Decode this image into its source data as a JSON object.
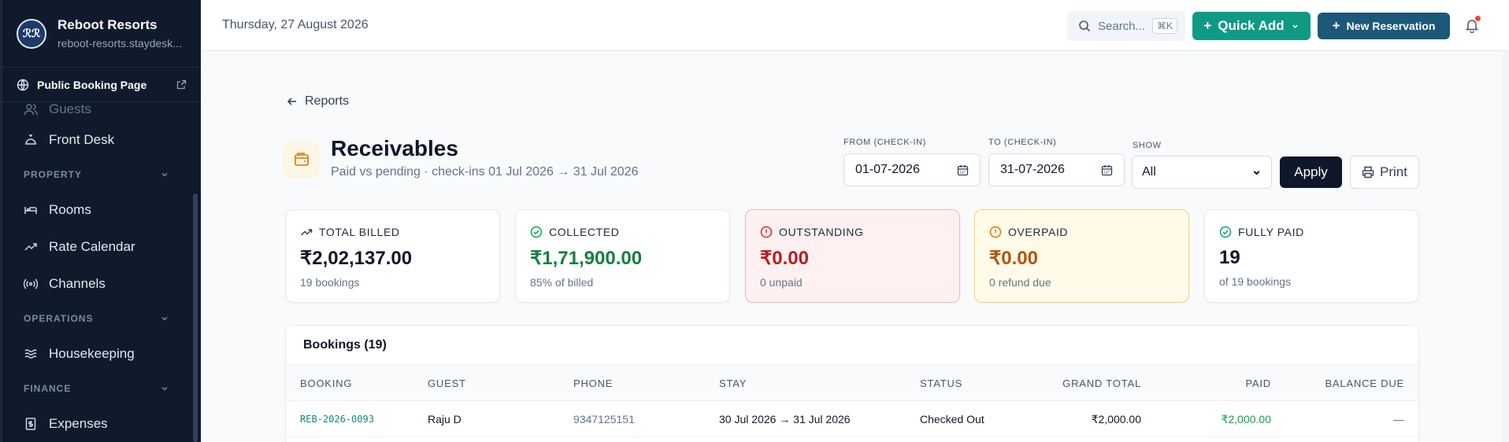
{
  "sidebar": {
    "brand_name": "Reboot Resorts",
    "brand_sub": "reboot-resorts.staydesk...",
    "logo_text": "ℛℛ",
    "public_link": "Public Booking Page",
    "items_top": [
      {
        "label": "Guests",
        "icon": "users-icon"
      },
      {
        "label": "Front Desk",
        "icon": "bell-service-icon"
      }
    ],
    "section_property": "PROPERTY",
    "items_property": [
      {
        "label": "Rooms",
        "icon": "bed-icon"
      },
      {
        "label": "Rate Calendar",
        "icon": "trending-up-icon"
      },
      {
        "label": "Channels",
        "icon": "broadcast-icon"
      }
    ],
    "section_operations": "OPERATIONS",
    "items_operations": [
      {
        "label": "Housekeeping",
        "icon": "waves-icon"
      }
    ],
    "section_finance": "FINANCE",
    "items_finance": [
      {
        "label": "Expenses",
        "icon": "receipt-icon"
      }
    ]
  },
  "topbar": {
    "date": "Thursday, 27 August 2026",
    "search_placeholder": "Search...",
    "search_shortcut": "⌘K",
    "quick_add": "Quick Add",
    "new_reservation": "New Reservation"
  },
  "page": {
    "back_label": "Reports",
    "title": "Receivables",
    "subtitle": "Paid vs pending · check-ins 01 Jul 2026 → 31 Jul 2026"
  },
  "filters": {
    "from_label": "FROM (CHECK-IN)",
    "from_value": "01-07-2026",
    "to_label": "TO (CHECK-IN)",
    "to_value": "31-07-2026",
    "show_label": "SHOW",
    "show_value": "All",
    "apply": "Apply",
    "print": "Print"
  },
  "kpis": [
    {
      "label": "TOTAL BILLED",
      "value": "₹2,02,137.00",
      "note": "19 bookings",
      "color": "#0f172a",
      "icon": "trending-up-icon"
    },
    {
      "label": "COLLECTED",
      "value": "₹1,71,900.00",
      "note": "85% of billed",
      "color": "#15803d",
      "icon": "check-circle-icon"
    },
    {
      "label": "OUTSTANDING",
      "value": "₹0.00",
      "note": "0 unpaid",
      "color": "#b91c1c",
      "icon": "alert-circle-icon"
    },
    {
      "label": "OVERPAID",
      "value": "₹0.00",
      "note": "0 refund due",
      "color": "#b45309",
      "icon": "alert-circle-icon"
    },
    {
      "label": "FULLY PAID",
      "value": "19",
      "note": "of 19 bookings",
      "color": "#0f172a",
      "icon": "check-circle-icon"
    }
  ],
  "table": {
    "title": "Bookings (19)",
    "columns": [
      "BOOKING",
      "GUEST",
      "PHONE",
      "STAY",
      "STATUS",
      "GRAND TOTAL",
      "PAID",
      "BALANCE DUE"
    ],
    "rows": [
      {
        "booking": "REB-2026-0093",
        "guest": "Raju D",
        "phone": "9347125151",
        "stay": "30 Jul 2026 → 31 Jul 2026",
        "status": "Checked Out",
        "grand_total": "₹2,000.00",
        "paid": "₹2,000.00",
        "balance": "—"
      }
    ]
  }
}
